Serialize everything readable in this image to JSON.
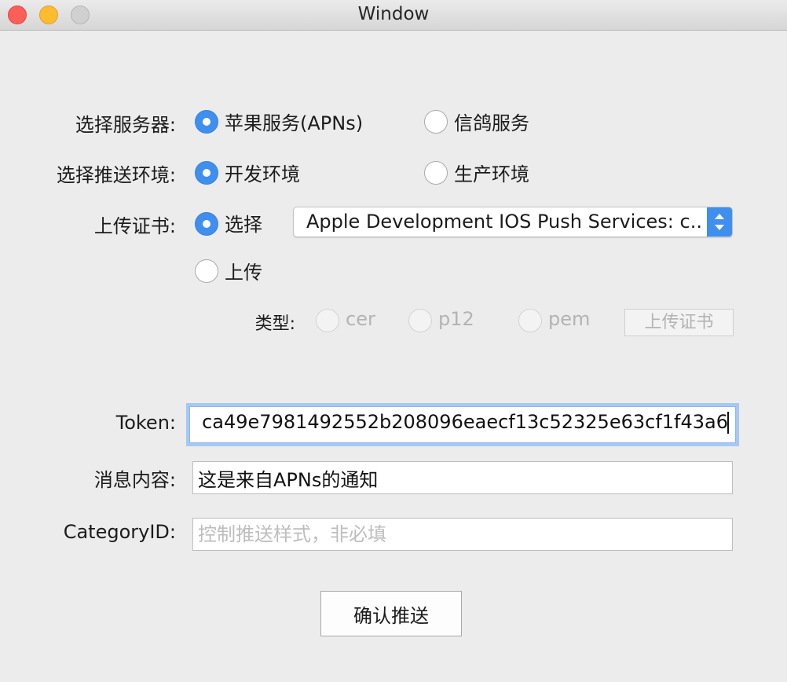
{
  "window": {
    "title": "Window"
  },
  "server": {
    "label": "选择服务器:",
    "options": [
      {
        "label": "苹果服务(APNs)",
        "selected": true
      },
      {
        "label": "信鸽服务",
        "selected": false
      }
    ]
  },
  "environment": {
    "label": "选择推送环境:",
    "options": [
      {
        "label": "开发环境",
        "selected": true
      },
      {
        "label": "生产环境",
        "selected": false
      }
    ]
  },
  "certificate": {
    "label": "上传证书:",
    "select_option": {
      "label": "选择",
      "selected": true
    },
    "selected_cert": "Apple Development IOS Push Services: c...",
    "upload_option": {
      "label": "上传",
      "selected": false
    },
    "type_label": "类型:",
    "types": [
      {
        "label": "cer",
        "selected": false
      },
      {
        "label": "p12",
        "selected": false
      },
      {
        "label": "pem",
        "selected": false
      }
    ],
    "upload_button": "上传证书"
  },
  "token": {
    "label": "Token:",
    "value": "ca49e7981492552b208096eaecf13c52325e63cf1f43a6"
  },
  "message": {
    "label": "消息内容:",
    "value": "这是来自APNs的通知"
  },
  "category": {
    "label": "CategoryID:",
    "placeholder": "控制推送样式，非必填",
    "value": ""
  },
  "submit": {
    "label": "确认推送"
  },
  "colors": {
    "accent": "#3f8fef",
    "focus_ring": "#a6c8f2",
    "background": "#ececec",
    "disabled_text": "#b3b3b3"
  }
}
